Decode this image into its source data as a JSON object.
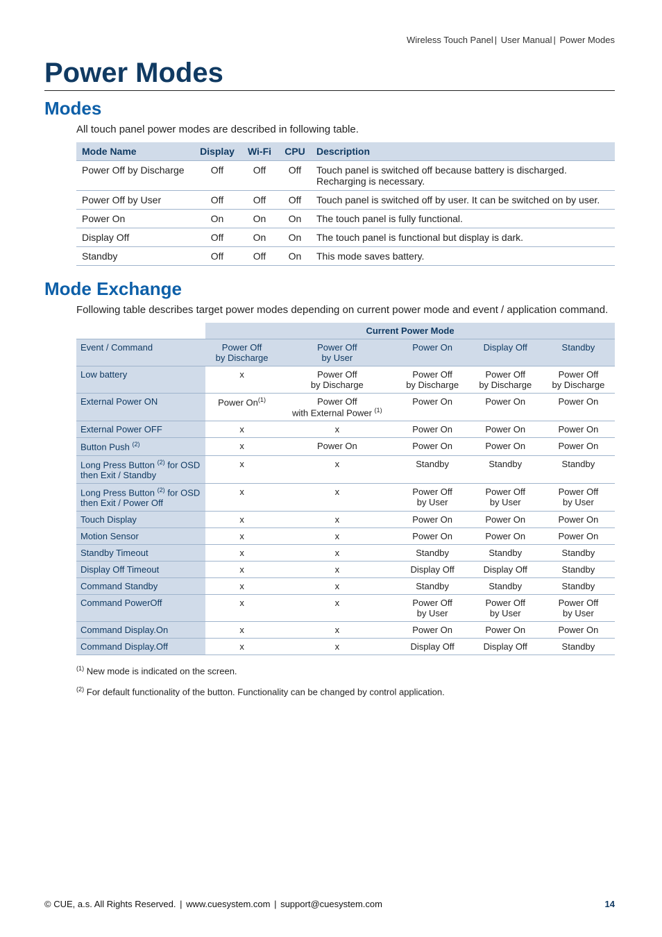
{
  "breadcrumb": [
    "Wireless Touch Panel",
    "User Manual",
    "Power Modes"
  ],
  "h1": "Power Modes",
  "modes": {
    "h2": "Modes",
    "intro": "All touch panel power modes are described in following table.",
    "cols": [
      "Mode Name",
      "Display",
      "Wi-Fi",
      "CPU",
      "Description"
    ],
    "rows": [
      [
        "Power Off by Discharge",
        "Off",
        "Off",
        "Off",
        "Touch panel is switched off because battery is discharged. Recharging is necessary."
      ],
      [
        "Power Off by User",
        "Off",
        "Off",
        "Off",
        "Touch panel is switched off by user. It can be switched on by user."
      ],
      [
        "Power On",
        "On",
        "On",
        "On",
        "The touch panel is fully functional."
      ],
      [
        "Display Off",
        "Off",
        "On",
        "On",
        "The touch panel is functional but display is dark."
      ],
      [
        "Standby",
        "Off",
        "Off",
        "On",
        "This mode saves battery."
      ]
    ]
  },
  "exchange": {
    "h2": "Mode Exchange",
    "intro": "Following table describes target power modes depending on current power mode and event / application command.",
    "top_header": "Current Power Mode",
    "row_header": "Event / Command",
    "cols": [
      "Power Off by Discharge",
      "Power Off by User",
      "Power On",
      "Display Off",
      "Standby"
    ],
    "rows": [
      {
        "label": "Low battery",
        "cells": [
          "x",
          "Power Off by Discharge",
          "Power Off by Discharge",
          "Power Off by Discharge",
          "Power Off by Discharge"
        ]
      },
      {
        "label": "External Power ON",
        "cells": [
          "Power On",
          "Power Off with External Power ",
          "Power On",
          "Power On",
          "Power On"
        ],
        "sup": [
          1,
          1,
          0,
          0,
          0
        ]
      },
      {
        "label": "External Power OFF",
        "cells": [
          "x",
          "x",
          "Power On",
          "Power On",
          "Power On"
        ]
      },
      {
        "label": "Button Push ",
        "label_sup": 2,
        "cells": [
          "x",
          "Power On",
          "Power On",
          "Power On",
          "Power On"
        ]
      },
      {
        "label": "Long Press Button  for OSD then Exit / Standby",
        "label_sup": 2,
        "label_sup_pos": 18,
        "cells": [
          "x",
          "x",
          "Standby",
          "Standby",
          "Standby"
        ]
      },
      {
        "label": "Long Press Button  for OSD then Exit / Power Off",
        "label_sup": 2,
        "label_sup_pos": 18,
        "cells": [
          "x",
          "x",
          "Power Off by User",
          "Power Off by User",
          "Power Off by User"
        ]
      },
      {
        "label": "Touch Display",
        "cells": [
          "x",
          "x",
          "Power On",
          "Power On",
          "Power On"
        ]
      },
      {
        "label": "Motion Sensor",
        "cells": [
          "x",
          "x",
          "Power On",
          "Power On",
          "Power On"
        ]
      },
      {
        "label": "Standby Timeout",
        "cells": [
          "x",
          "x",
          "Standby",
          "Standby",
          "Standby"
        ]
      },
      {
        "label": "Display Off Timeout",
        "cells": [
          "x",
          "x",
          "Display Off",
          "Display Off",
          "Standby"
        ]
      },
      {
        "label": "Command Standby",
        "cells": [
          "x",
          "x",
          "Standby",
          "Standby",
          "Standby"
        ]
      },
      {
        "label": "Command PowerOff",
        "cells": [
          "x",
          "x",
          "Power Off by User",
          "Power Off by User",
          "Power Off by User"
        ]
      },
      {
        "label": "Command Display.On",
        "cells": [
          "x",
          "x",
          "Power On",
          "Power On",
          "Power On"
        ]
      },
      {
        "label": "Command Display.Off",
        "cells": [
          "x",
          "x",
          "Display Off",
          "Display Off",
          "Standby"
        ]
      }
    ]
  },
  "footnotes": [
    "New mode is indicated on the screen.",
    "For default functionality of the button. Functionality can be changed by control application."
  ],
  "footer": {
    "copyright": "© CUE, a.s. All Rights Reserved.",
    "web": "www.cuesystem.com",
    "email": "support@cuesystem.com",
    "page": "14"
  }
}
